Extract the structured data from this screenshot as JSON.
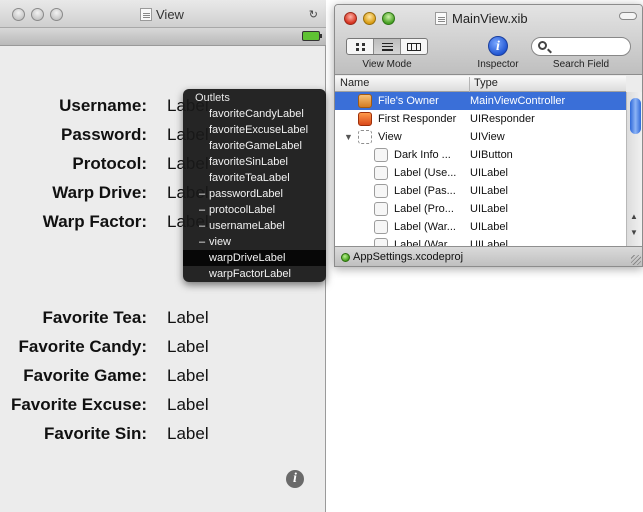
{
  "view_window": {
    "title": "View",
    "form": [
      {
        "label": "Username:",
        "value": "Label"
      },
      {
        "label": "Password:",
        "value": "Label"
      },
      {
        "label": "Protocol:",
        "value": "Label"
      },
      {
        "label": "Warp Drive:",
        "value": "Label"
      },
      {
        "label": "Warp Factor:",
        "value": "Label"
      },
      {
        "label": "Favorite Tea:",
        "value": "Label"
      },
      {
        "label": "Favorite Candy:",
        "value": "Label"
      },
      {
        "label": "Favorite Game:",
        "value": "Label"
      },
      {
        "label": "Favorite Excuse:",
        "value": "Label"
      },
      {
        "label": "Favorite Sin:",
        "value": "Label"
      }
    ],
    "info_glyph": "i"
  },
  "outlets_hud": {
    "title": "Outlets",
    "items": [
      {
        "label": "favoriteCandyLabel",
        "connected": false
      },
      {
        "label": "favoriteExcuseLabel",
        "connected": false
      },
      {
        "label": "favoriteGameLabel",
        "connected": false
      },
      {
        "label": "favoriteSinLabel",
        "connected": false
      },
      {
        "label": "favoriteTeaLabel",
        "connected": false
      },
      {
        "label": "passwordLabel",
        "connected": true
      },
      {
        "label": "protocolLabel",
        "connected": true
      },
      {
        "label": "usernameLabel",
        "connected": true
      },
      {
        "label": "view",
        "connected": true
      },
      {
        "label": "warpDriveLabel",
        "connected": false,
        "selected": true
      },
      {
        "label": "warpFactorLabel",
        "connected": false
      }
    ]
  },
  "xib_window": {
    "title": "MainView.xib",
    "toolbar": {
      "view_mode_label": "View Mode",
      "inspector_label": "Inspector",
      "inspector_glyph": "i",
      "search_label": "Search Field",
      "search_placeholder": ""
    },
    "columns": {
      "name": "Name",
      "type": "Type"
    },
    "rows": [
      {
        "name": "File's Owner",
        "type": "MainViewController",
        "icon": "files-owner-icon",
        "level": 0,
        "selected": true
      },
      {
        "name": "First Responder",
        "type": "UIResponder",
        "icon": "first-responder-icon",
        "level": 0
      },
      {
        "name": "View",
        "type": "UIView",
        "icon": "view-icon",
        "level": 0,
        "expanded": true
      },
      {
        "name": "Dark Info ...",
        "type": "UIButton",
        "icon": "object-icon",
        "level": 1
      },
      {
        "name": "Label (Use...",
        "type": "UILabel",
        "icon": "object-icon",
        "level": 1
      },
      {
        "name": "Label (Pas...",
        "type": "UILabel",
        "icon": "object-icon",
        "level": 1
      },
      {
        "name": "Label (Pro...",
        "type": "UILabel",
        "icon": "object-icon",
        "level": 1
      },
      {
        "name": "Label (War...",
        "type": "UILabel",
        "icon": "object-icon",
        "level": 1
      },
      {
        "name": "Label (War...",
        "type": "UILabel",
        "icon": "object-icon",
        "level": 1
      }
    ],
    "footer": {
      "project": "AppSettings.xcodeproj"
    }
  },
  "colors": {
    "selection": "#3a6fd8",
    "hud_bg": "#181818",
    "window_bg": "#ececec"
  }
}
